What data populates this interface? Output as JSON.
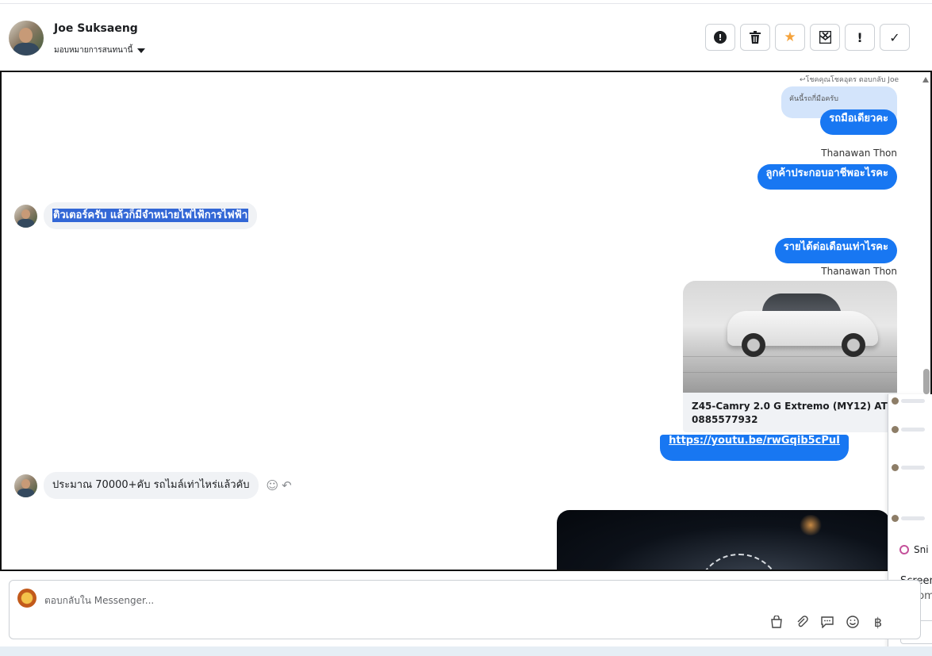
{
  "header": {
    "contact_name": "Joe Suksaeng",
    "assign_label": "มอบหมายการสนทนานี้",
    "toolbar": {
      "spam": "!",
      "check": "✓",
      "alert": "!"
    }
  },
  "conversation": {
    "reply_note": "↩โชคคุณโชคอุดร ตอบกลับ Joe",
    "quoted_text": "คันนี้รถกี่มือครับ",
    "out_msg_1": "รถมือเดียวคะ",
    "sender_1": "Thanawan Thon",
    "out_msg_2": "ลูกค้าประกอบอาชีพอะไรคะ",
    "in_msg_1": "ติวเตอร์ครับ แล้วก็มีจำหน่ายไฟไฟ้การไฟฟ้า",
    "out_msg_3": "รายได้ต่อเดือนเท่าไรคะ",
    "sender_2": "Thanawan Thon",
    "card_title": "Z45-Camry 2.0 G Extremo (MY12) AT 0885577932",
    "link": "https://youtu.be/rwGqib5cPuI",
    "in_msg_2": "ประมาณ 70000+คับ รถไมล์เท่าไหร่แล้วคับ"
  },
  "side_panel": {
    "snip_label": "Sni",
    "text_1": "Screen",
    "text_2": "Autom"
  },
  "composer": {
    "placeholder": "ตอบกลับใน Messenger..."
  },
  "colors": {
    "accent": "#1877f2",
    "incoming_bubble": "#f0f2f5",
    "quoted_bubble": "#d3e4fb",
    "star": "#f5a33c"
  }
}
